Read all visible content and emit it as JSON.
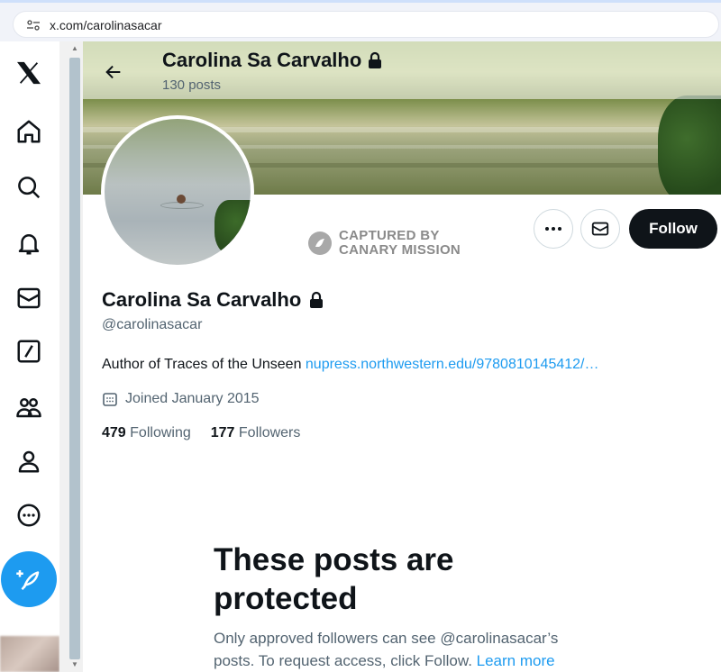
{
  "browser": {
    "url": "x.com/carolinasacar",
    "icons": {
      "site_info": "tune-icon"
    }
  },
  "nav": {
    "items": [
      {
        "name": "x-logo-icon"
      },
      {
        "name": "home-icon"
      },
      {
        "name": "search-icon"
      },
      {
        "name": "notifications-bell-icon"
      },
      {
        "name": "messages-envelope-icon"
      },
      {
        "name": "grok-icon"
      },
      {
        "name": "communities-icon"
      },
      {
        "name": "profile-icon"
      },
      {
        "name": "more-circle-icon"
      }
    ],
    "post_button_icon": "feather-plus-icon"
  },
  "header": {
    "display_name": "Carolina Sa Carvalho",
    "posts_count": "130 posts"
  },
  "watermark": {
    "line1": "CAPTURED BY",
    "line2": "CANARY MISSION"
  },
  "profile": {
    "display_name": "Carolina Sa Carvalho",
    "handle": "@carolinasacar",
    "bio_text": "Author of Traces of the Unseen ",
    "bio_link": "nupress.northwestern.edu/9780810145412/…",
    "joined": "Joined January 2015",
    "following_count": "479",
    "following_label": "Following",
    "followers_count": "177",
    "followers_label": "Followers"
  },
  "actions": {
    "follow_label": "Follow"
  },
  "protected": {
    "title": "These posts are protected",
    "body": "Only approved followers can see @carolinasacar’s posts. To request access, click Follow. ",
    "learn_more": "Learn more"
  },
  "colors": {
    "accent": "#1d9bf0",
    "text_primary": "#0f1419",
    "text_secondary": "#536471",
    "follow_button": "#0f1419"
  }
}
